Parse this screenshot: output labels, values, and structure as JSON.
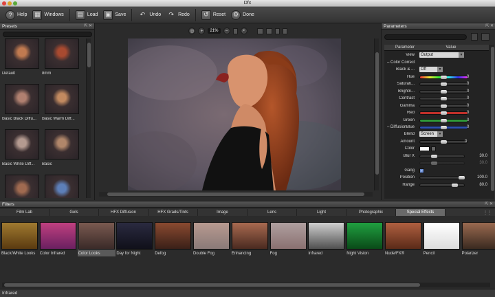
{
  "window": {
    "title": "Dfx"
  },
  "toolbar": {
    "help": "Help",
    "windows": "Windows",
    "load": "Load",
    "save": "Save",
    "undo": "Undo",
    "redo": "Redo",
    "reset": "Reset",
    "done": "Done"
  },
  "presets": {
    "title": "Presets",
    "items": [
      "Default",
      "8mm",
      "Basic Black Diffu...",
      "Basic Warm Diff...",
      "Basic White Diff...",
      "Basic",
      "",
      ""
    ]
  },
  "viewer": {
    "zoom": "21%"
  },
  "params": {
    "title": "Parameters",
    "col_parameter": "Parameter",
    "col_value": "Value",
    "view_label": "View",
    "view_value": "Output",
    "color_correct": "Color Correct",
    "black_label": "Black & ...",
    "black_value": "Off",
    "hue": "Hue",
    "hue_val": "0",
    "saturation": "Saturati...",
    "saturation_val": "0",
    "brightness": "Brightn...",
    "brightness_val": "0",
    "contrast": "Contrast",
    "contrast_val": "0",
    "gamma": "Gamma",
    "gamma_val": "0",
    "red": "Red",
    "red_val": "0",
    "green": "Green",
    "green_val": "0",
    "blue": "Blue",
    "blue_val": "0",
    "diffusion": "Diffusion",
    "blend": "Blend",
    "blend_value": "Screen",
    "amount": "Amount",
    "amount_val": "0",
    "color": "Color",
    "blurx": "Blur X",
    "blurx_val": "30.0",
    "blury_val": "30.0",
    "gang": "Gang",
    "position": "Position",
    "position_val": "100.0",
    "range": "Range",
    "range_val": "80.0"
  },
  "filters": {
    "title": "Filters",
    "tabs": [
      "Film Lab",
      "Gels",
      "HFX Diffusion",
      "HFX Grads/Tints",
      "Image",
      "Lens",
      "Light",
      "Photographic",
      "Special Effects"
    ],
    "active_tab": "Special Effects",
    "items": [
      "Black/White Looks",
      "Color Infrared",
      "Color Looks",
      "Day for Night",
      "Defog",
      "Double Fog",
      "Enhancing",
      "Fog",
      "Infrared",
      "Night Vision",
      "Nude/FX®",
      "Pencil",
      "Polarizer"
    ],
    "selected": "Color Looks"
  },
  "status": {
    "text": "Infrared"
  },
  "colors": {
    "accent": "#6a6a6a",
    "hue_gradient": "rainbow",
    "red_slider": "#c0302a",
    "green_slider": "#2f9a3a",
    "blue_slider": "#2f4fb0"
  }
}
